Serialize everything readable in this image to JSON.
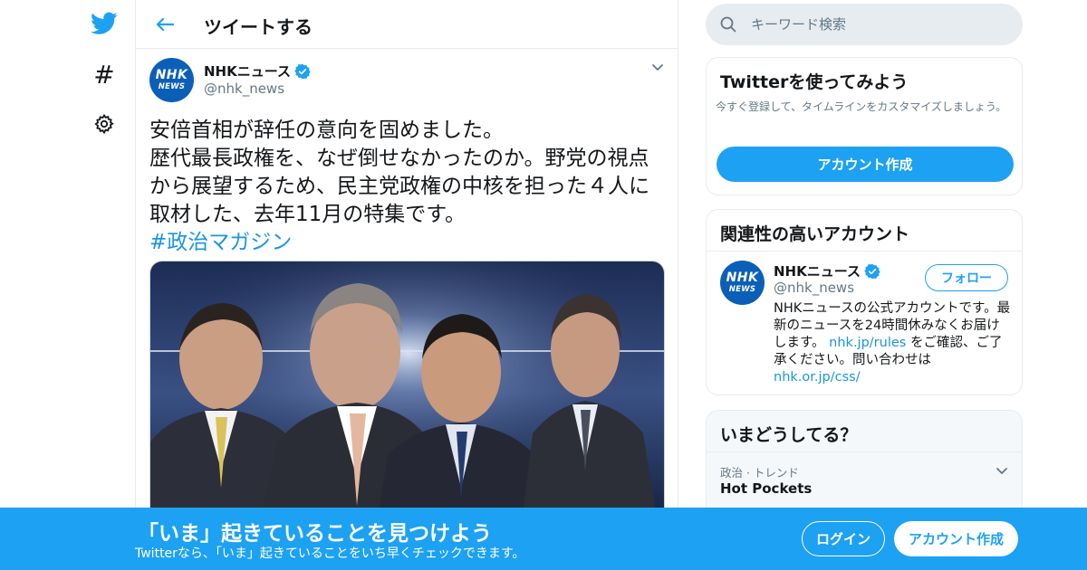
{
  "colors": {
    "brand": "#1da1f2",
    "link": "#1b95e0",
    "secondary_text": "#657786",
    "border": "#e6ecf0",
    "nhk_blue": "#0b5fb7"
  },
  "leftnav": {
    "icons": [
      "twitter-bird-icon",
      "hashtag-icon",
      "gear-icon"
    ],
    "hashtag_glyph": "#"
  },
  "header": {
    "back_icon": "arrow-left-icon",
    "title": "ツイートする"
  },
  "tweet": {
    "avatar": {
      "line1": "NHK",
      "line2": "NEWS"
    },
    "name": "NHKニュース",
    "verified_icon": "verified-badge-icon",
    "handle": "@nhk_news",
    "menu_icon": "chevron-down-icon",
    "text_lines": [
      "安倍首相が辞任の意向を固めました。",
      "歴代最長政権を、なぜ倒せなかったのか。野党の視点",
      "から展望するため、民主党政権の中核を担った４人に",
      "取材した、去年11月の特集です。"
    ],
    "hashtag": "#政治マガジン",
    "image_description_icon": "photo-four-politicians"
  },
  "search": {
    "icon": "search-icon",
    "placeholder": "キーワード検索"
  },
  "signup_card": {
    "title": "Twitterを使ってみよう",
    "description": "今すぐ登録して、タイムラインをカスタマイズしましょう。",
    "button": "アカウント作成"
  },
  "related_card": {
    "title": "関連性の高いアカウント",
    "account": {
      "avatar": {
        "line1": "NHK",
        "line2": "NEWS"
      },
      "name": "NHKニュース",
      "handle": "@nhk_news",
      "follow_button": "フォロー",
      "bio_part1": "NHKニュースの公式アカウントです。最新のニュースを24時間休みなくお届けします。",
      "bio_link1": "nhk.jp/rules",
      "bio_part2": "をご確認、ご了承ください。問い合わせは",
      "bio_link2": "nhk.or.jp/css/"
    }
  },
  "trends_card": {
    "title": "いまどうしてる？",
    "items": [
      {
        "meta": "政治 · トレンド",
        "name": "Hot Pockets"
      }
    ]
  },
  "bottom_bar": {
    "title": "「いま」起きていることを見つけよう",
    "subtitle": "Twitterなら、「いま」起きていることをいち早くチェックできます。",
    "login_button": "ログイン",
    "signup_button": "アカウント作成"
  }
}
